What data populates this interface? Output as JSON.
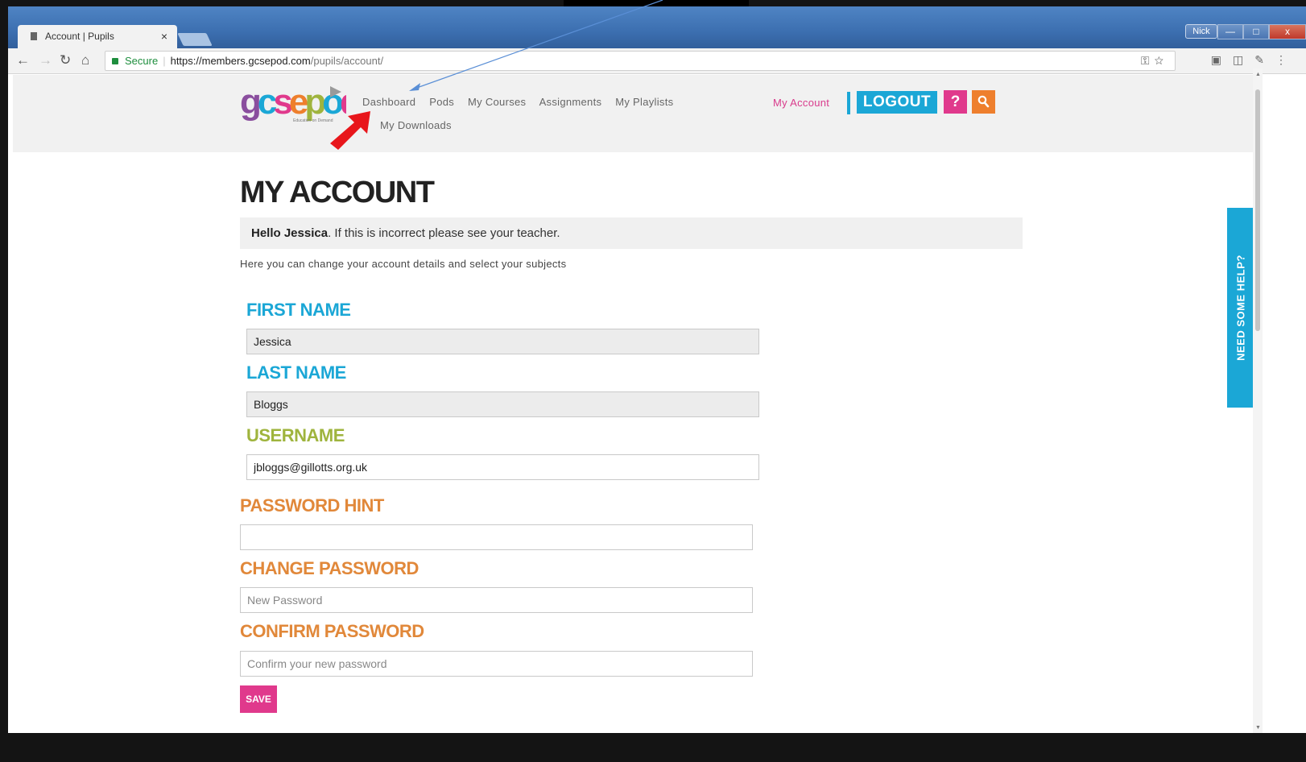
{
  "browser": {
    "tab_title": "Account | Pupils",
    "tab_close": "×",
    "user_name": "Nick",
    "url_secure_label": "Secure",
    "url_scheme_host": "https://members.gcsepod.com",
    "url_path": "/pupils/account/",
    "window_minimize": "—",
    "window_maximize": "□",
    "window_close": "x"
  },
  "header": {
    "logo_text": "gcsepod",
    "logo_tagline": "Education on Demand",
    "nav": {
      "dashboard": "Dashboard",
      "pods": "Pods",
      "my_courses": "My Courses",
      "assignments": "Assignments",
      "my_playlists": "My Playlists",
      "my_downloads": "My Downloads"
    },
    "my_account": "My Account",
    "logout": "LOGOUT",
    "help": "?"
  },
  "page": {
    "title": "MY ACCOUNT",
    "hello_name": "Hello Jessica",
    "hello_rest": ". If this is incorrect please see your teacher.",
    "intro": "Here you can change your account details and select your subjects"
  },
  "form": {
    "first_name_label": "FIRST NAME",
    "first_name_value": "Jessica",
    "last_name_label": "LAST NAME",
    "last_name_value": "Bloggs",
    "username_label": "USERNAME",
    "username_value": "jbloggs@gillotts.org.uk",
    "password_hint_label": "PASSWORD HINT",
    "password_hint_value": "",
    "change_password_label": "CHANGE PASSWORD",
    "change_password_placeholder": "New Password",
    "confirm_password_label": "CONFIRM PASSWORD",
    "confirm_password_placeholder": "Confirm your new password",
    "save_label": "SAVE"
  },
  "side_help": {
    "label": "NEED SOME HELP?"
  },
  "colors": {
    "brand_blue": "#1ba7d6",
    "brand_pink": "#e0398c",
    "brand_orange": "#ee7f2d",
    "label_green": "#9fb43d",
    "label_orange": "#e1883a",
    "annotation_red": "#e8161b",
    "annotation_arrow_blue": "#5a8fd6"
  }
}
